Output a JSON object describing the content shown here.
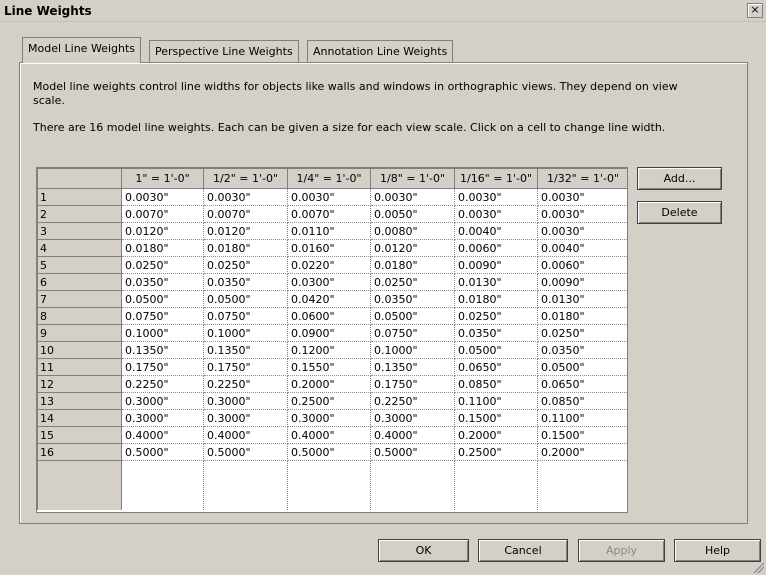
{
  "window": {
    "title": "Line Weights",
    "close_glyph": "×"
  },
  "tabs": [
    {
      "label": "Model Line Weights",
      "active": true
    },
    {
      "label": "Perspective Line Weights",
      "active": false
    },
    {
      "label": "Annotation Line Weights",
      "active": false
    }
  ],
  "description": {
    "line1": "Model line weights control line widths for objects like walls and windows in orthographic views. They depend on view",
    "line2": "scale.",
    "line3": "There are 16 model line weights. Each can be given a size for each view scale. Click on a cell to change line width."
  },
  "table": {
    "columns": [
      "1\" = 1'-0\"",
      "1/2\" = 1'-0\"",
      "1/4\" = 1'-0\"",
      "1/8\" = 1'-0\"",
      "1/16\" = 1'-0\"",
      "1/32\" = 1'-0\""
    ],
    "rows": [
      {
        "label": "1",
        "values": [
          "0.0030\"",
          "0.0030\"",
          "0.0030\"",
          "0.0030\"",
          "0.0030\"",
          "0.0030\""
        ]
      },
      {
        "label": "2",
        "values": [
          "0.0070\"",
          "0.0070\"",
          "0.0070\"",
          "0.0050\"",
          "0.0030\"",
          "0.0030\""
        ]
      },
      {
        "label": "3",
        "values": [
          "0.0120\"",
          "0.0120\"",
          "0.0110\"",
          "0.0080\"",
          "0.0040\"",
          "0.0030\""
        ]
      },
      {
        "label": "4",
        "values": [
          "0.0180\"",
          "0.0180\"",
          "0.0160\"",
          "0.0120\"",
          "0.0060\"",
          "0.0040\""
        ]
      },
      {
        "label": "5",
        "values": [
          "0.0250\"",
          "0.0250\"",
          "0.0220\"",
          "0.0180\"",
          "0.0090\"",
          "0.0060\""
        ]
      },
      {
        "label": "6",
        "values": [
          "0.0350\"",
          "0.0350\"",
          "0.0300\"",
          "0.0250\"",
          "0.0130\"",
          "0.0090\""
        ]
      },
      {
        "label": "7",
        "values": [
          "0.0500\"",
          "0.0500\"",
          "0.0420\"",
          "0.0350\"",
          "0.0180\"",
          "0.0130\""
        ]
      },
      {
        "label": "8",
        "values": [
          "0.0750\"",
          "0.0750\"",
          "0.0600\"",
          "0.0500\"",
          "0.0250\"",
          "0.0180\""
        ]
      },
      {
        "label": "9",
        "values": [
          "0.1000\"",
          "0.1000\"",
          "0.0900\"",
          "0.0750\"",
          "0.0350\"",
          "0.0250\""
        ]
      },
      {
        "label": "10",
        "values": [
          "0.1350\"",
          "0.1350\"",
          "0.1200\"",
          "0.1000\"",
          "0.0500\"",
          "0.0350\""
        ]
      },
      {
        "label": "11",
        "values": [
          "0.1750\"",
          "0.1750\"",
          "0.1550\"",
          "0.1350\"",
          "0.0650\"",
          "0.0500\""
        ]
      },
      {
        "label": "12",
        "values": [
          "0.2250\"",
          "0.2250\"",
          "0.2000\"",
          "0.1750\"",
          "0.0850\"",
          "0.0650\""
        ]
      },
      {
        "label": "13",
        "values": [
          "0.3000\"",
          "0.3000\"",
          "0.2500\"",
          "0.2250\"",
          "0.1100\"",
          "0.0850\""
        ]
      },
      {
        "label": "14",
        "values": [
          "0.3000\"",
          "0.3000\"",
          "0.3000\"",
          "0.3000\"",
          "0.1500\"",
          "0.1100\""
        ]
      },
      {
        "label": "15",
        "values": [
          "0.4000\"",
          "0.4000\"",
          "0.4000\"",
          "0.4000\"",
          "0.2000\"",
          "0.1500\""
        ]
      },
      {
        "label": "16",
        "values": [
          "0.5000\"",
          "0.5000\"",
          "0.5000\"",
          "0.5000\"",
          "0.2500\"",
          "0.2000\""
        ]
      }
    ]
  },
  "side_buttons": {
    "add": "Add...",
    "delete": "Delete"
  },
  "footer_buttons": {
    "ok": "OK",
    "cancel": "Cancel",
    "apply": "Apply",
    "help": "Help"
  }
}
